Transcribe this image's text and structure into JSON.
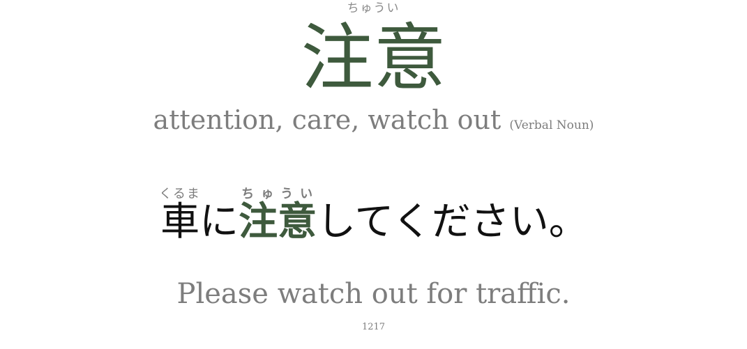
{
  "headword": {
    "reading": "ちゅうい",
    "word": "注意",
    "meaning": "attention, care, watch out",
    "part_of_speech": "(Verbal Noun)"
  },
  "example": {
    "parts": {
      "p1": {
        "text": "車",
        "reading": "くるま"
      },
      "p2": {
        "text": "に"
      },
      "p3": {
        "text": "注意",
        "reading": "ちゅうい"
      },
      "p4": {
        "text": "してください。"
      }
    },
    "translation": "Please watch out for traffic."
  },
  "card_number": "1217",
  "colors": {
    "highlight": "#3e5a3d",
    "muted": "#7d7d7d",
    "text": "#111111"
  }
}
